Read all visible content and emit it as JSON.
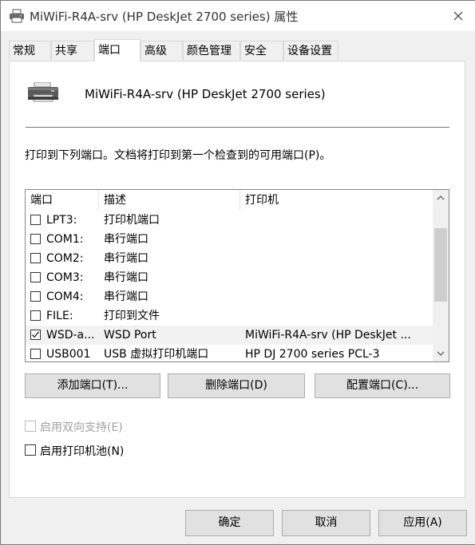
{
  "window": {
    "title": "MiWiFi-R4A-srv (HP DeskJet 2700 series) 属性"
  },
  "tabs": [
    {
      "label": "常规"
    },
    {
      "label": "共享"
    },
    {
      "label": "端口",
      "active": true
    },
    {
      "label": "高级"
    },
    {
      "label": "颜色管理"
    },
    {
      "label": "安全"
    },
    {
      "label": "设备设置"
    }
  ],
  "printer": {
    "name": "MiWiFi-R4A-srv (HP DeskJet 2700 series)",
    "icon": "printer-icon"
  },
  "instruction": "打印到下列端口。文档将打印到第一个检查到的可用端口(P)。",
  "port_list": {
    "headers": [
      "端口",
      "描述",
      "打印机"
    ],
    "rows": [
      {
        "port": "LPT3:",
        "desc": "打印机端口",
        "printer": "",
        "checked": false
      },
      {
        "port": "COM1:",
        "desc": "串行端口",
        "printer": "",
        "checked": false
      },
      {
        "port": "COM2:",
        "desc": "串行端口",
        "printer": "",
        "checked": false
      },
      {
        "port": "COM3:",
        "desc": "串行端口",
        "printer": "",
        "checked": false
      },
      {
        "port": "COM4:",
        "desc": "串行端口",
        "printer": "",
        "checked": false
      },
      {
        "port": "FILE:",
        "desc": "打印到文件",
        "printer": "",
        "checked": false
      },
      {
        "port": "WSD-a...",
        "desc": "WSD Port",
        "printer": "MiWiFi-R4A-srv (HP DeskJet ...",
        "checked": true,
        "selected": true
      },
      {
        "port": "USB001",
        "desc": "USB 虚拟打印机端口",
        "printer": "HP DJ 2700 series PCL-3",
        "checked": false
      }
    ]
  },
  "port_buttons": {
    "add": "添加端口(T)...",
    "delete": "删除端口(D)",
    "configure": "配置端口(C)..."
  },
  "options": {
    "bidirectional": {
      "label": "启用双向支持(E)",
      "checked": false,
      "disabled": true
    },
    "pooling": {
      "label": "启用打印机池(N)",
      "checked": false,
      "disabled": false
    }
  },
  "dialog_buttons": {
    "ok": "确定",
    "cancel": "取消",
    "apply": "应用(A)"
  }
}
